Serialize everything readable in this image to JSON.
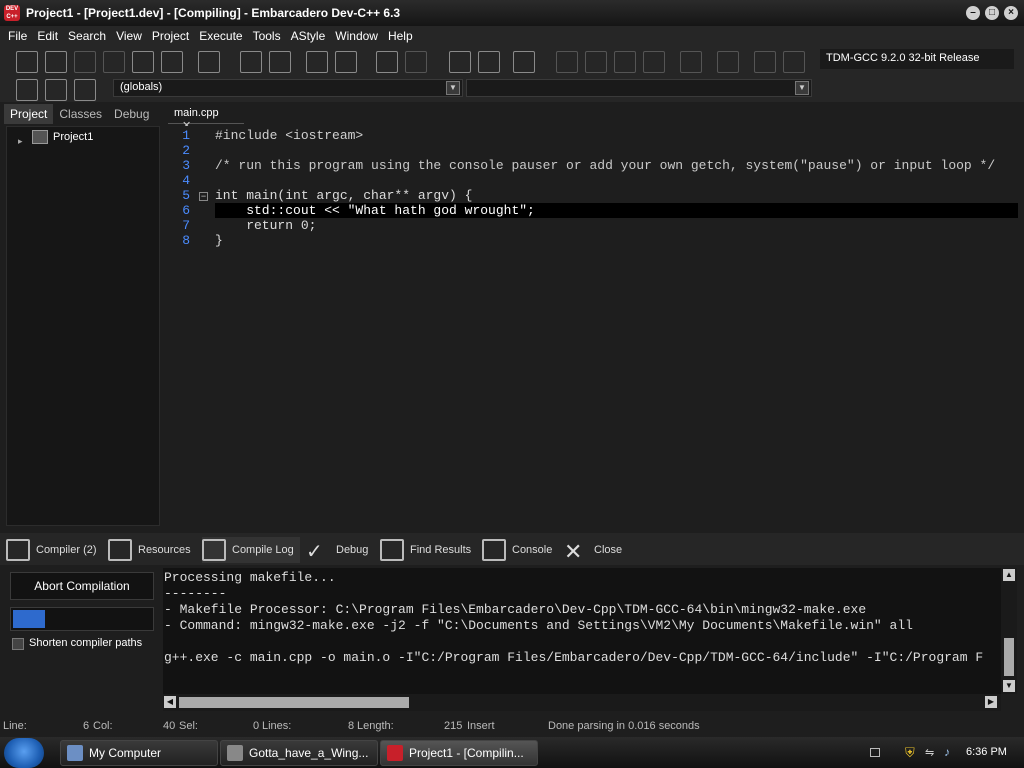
{
  "window": {
    "title": "Project1 - [Project1.dev] - [Compiling] - Embarcadero Dev-C++ 6.3",
    "app_icon_text": "DEV C++"
  },
  "menu": [
    "File",
    "Edit",
    "Search",
    "View",
    "Project",
    "Execute",
    "Tools",
    "AStyle",
    "Window",
    "Help"
  ],
  "toolbar": {
    "compiler": "TDM-GCC 9.2.0 32-bit Release",
    "globals": "(globals)",
    "func": ""
  },
  "left_tabs": [
    "Project",
    "Classes",
    "Debug"
  ],
  "project_tree": {
    "root": "Project1"
  },
  "editor": {
    "tab": "main.cpp",
    "line_numbers": [
      "1",
      "2",
      "3",
      "4",
      "5",
      "6",
      "7",
      "8"
    ],
    "lines": [
      "#include <iostream>",
      "",
      "/* run this program using the console pauser or add your own getch, system(\"pause\") or input loop */",
      "",
      "int main(int argc, char** argv) {",
      "    std::cout << \"What hath god wrought\";",
      "    return 0;",
      "}"
    ]
  },
  "bottom_tabs": [
    "Compiler (2)",
    "Resources",
    "Compile Log",
    "Debug",
    "Find Results",
    "Console",
    "Close"
  ],
  "compile_panel": {
    "abort_label": "Abort Compilation",
    "progress": 0.23,
    "shorten_label": "Shorten compiler paths"
  },
  "log_lines": [
    "Processing makefile...",
    "--------",
    "- Makefile Processor: C:\\Program Files\\Embarcadero\\Dev-Cpp\\TDM-GCC-64\\bin\\mingw32-make.exe",
    "- Command: mingw32-make.exe -j2 -f \"C:\\Documents and Settings\\VM2\\My Documents\\Makefile.win\" all",
    "",
    "g++.exe -c main.cpp -o main.o -I\"C:/Program Files/Embarcadero/Dev-Cpp/TDM-GCC-64/include\" -I\"C:/Program F"
  ],
  "status": {
    "line_label": "Line:",
    "line_val": "6",
    "col_label": "Col:",
    "col_val": "40",
    "sel_label": "Sel:",
    "sel_val": "0",
    "lines_label": "Lines:",
    "lines_val": "8",
    "length_label": "Length:",
    "length_val": "215",
    "mode": "Insert",
    "message": "Done parsing in 0.016 seconds"
  },
  "taskbar": {
    "items": [
      "My Computer",
      "Gotta_have_a_Wing...",
      "Project1 - [Compilin..."
    ],
    "clock": "6:36 PM"
  },
  "colors": {
    "accent": "#4b8cff",
    "keyword": "#4b8cff",
    "string": "#e8e8e8",
    "comment": "#c9c9c9"
  }
}
